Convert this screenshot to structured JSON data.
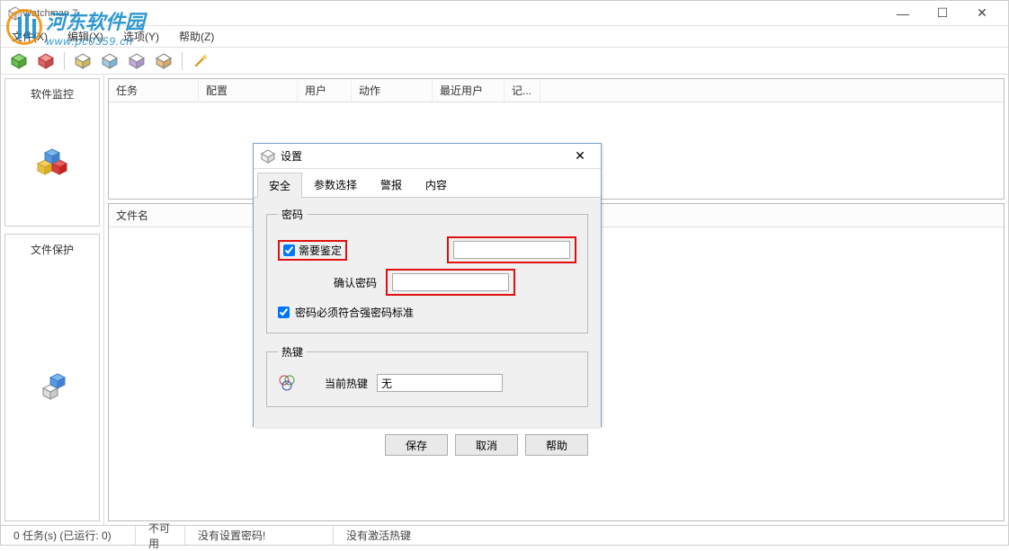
{
  "window": {
    "title": "Watchman 7"
  },
  "menu": {
    "file": "文件(X)",
    "edit": "编辑(X)",
    "options": "选项(Y)",
    "help": "帮助(Z)"
  },
  "watermark": {
    "brand": "河东软件园",
    "url": "www.pc0359.cn"
  },
  "left_panel": {
    "section1_title": "软件监控",
    "section2_title": "文件保护"
  },
  "top_list": {
    "cols": [
      "任务",
      "配置",
      "用户",
      "动作",
      "最近用户",
      "记..."
    ]
  },
  "bottom_list": {
    "col1": "文件名"
  },
  "statusbar": {
    "tasks": "0 任务(s) (已运行: 0)",
    "unavailable": "不可用",
    "no_password": "没有设置密码!",
    "no_hotkey": "没有激活热键"
  },
  "dialog": {
    "title": "设置",
    "tabs": {
      "security": "安全",
      "params": "参数选择",
      "alarm": "警报",
      "content": "内容"
    },
    "group_password": "密码",
    "chk_require_auth": "需要鉴定",
    "lbl_confirm_pw": "确认密码",
    "chk_strong_pw": "密码必须符合强密码标准",
    "group_hotkey": "热键",
    "lbl_current_hotkey": "当前热键",
    "hotkey_value": "无",
    "btn_save": "保存",
    "btn_cancel": "取消",
    "btn_help": "帮助"
  }
}
